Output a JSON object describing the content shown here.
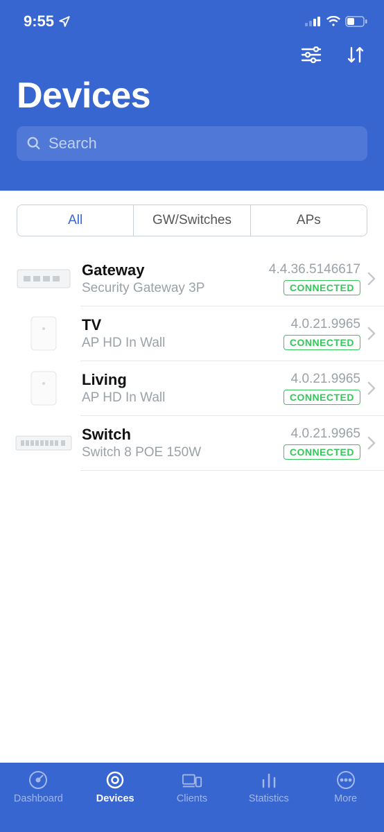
{
  "status": {
    "time": "9:55"
  },
  "header": {
    "title": "Devices"
  },
  "search": {
    "placeholder": "Search"
  },
  "tabs": [
    {
      "label": "All",
      "active": true
    },
    {
      "label": "GW/Switches",
      "active": false
    },
    {
      "label": "APs",
      "active": false
    }
  ],
  "devices": [
    {
      "name": "Gateway",
      "model": "Security Gateway 3P",
      "version": "4.4.36.5146617",
      "status": "CONNECTED",
      "type": "gateway"
    },
    {
      "name": "TV",
      "model": "AP HD In Wall",
      "version": "4.0.21.9965",
      "status": "CONNECTED",
      "type": "ap"
    },
    {
      "name": "Living",
      "model": "AP HD In Wall",
      "version": "4.0.21.9965",
      "status": "CONNECTED",
      "type": "ap"
    },
    {
      "name": "Switch",
      "model": "Switch 8 POE 150W",
      "version": "4.0.21.9965",
      "status": "CONNECTED",
      "type": "switch"
    }
  ],
  "nav": [
    {
      "label": "Dashboard",
      "icon": "gauge",
      "active": false
    },
    {
      "label": "Devices",
      "icon": "ring",
      "active": true
    },
    {
      "label": "Clients",
      "icon": "clients",
      "active": false
    },
    {
      "label": "Statistics",
      "icon": "bars",
      "active": false
    },
    {
      "label": "More",
      "icon": "dots",
      "active": false
    }
  ]
}
